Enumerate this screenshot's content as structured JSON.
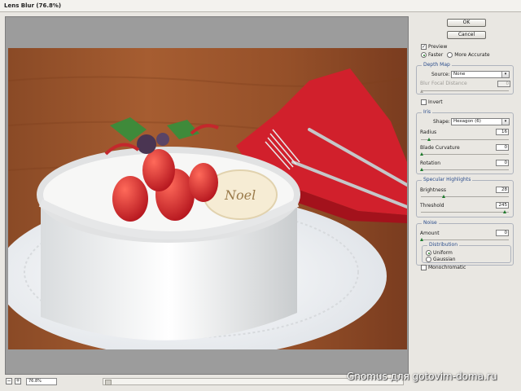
{
  "window": {
    "title": "Lens Blur (76.8%)"
  },
  "buttons": {
    "ok": "OK",
    "cancel": "Cancel"
  },
  "preview": {
    "label": "Preview",
    "checked": true,
    "faster": "Faster",
    "more_accurate": "More Accurate",
    "selected": "Faster"
  },
  "depth_map": {
    "legend": "Depth Map",
    "source_label": "Source:",
    "source_value": "None",
    "blur_focal_label": "Blur Focal Distance",
    "blur_focal_value": "0",
    "invert_label": "Invert"
  },
  "iris": {
    "legend": "Iris",
    "shape_label": "Shape:",
    "shape_value": "Hexagon (6)",
    "radius_label": "Radius",
    "radius_value": "16",
    "blade_curvature_label": "Blade Curvature",
    "blade_curvature_value": "0",
    "rotation_label": "Rotation",
    "rotation_value": "0"
  },
  "specular": {
    "legend": "Specular Highlights",
    "brightness_label": "Brightness",
    "brightness_value": "28",
    "threshold_label": "Threshold",
    "threshold_value": "245"
  },
  "noise": {
    "legend": "Noise",
    "amount_label": "Amount",
    "amount_value": "0",
    "distribution_legend": "Distribution",
    "uniform": "Uniform",
    "gaussian": "Gaussian",
    "selected": "Uniform",
    "monochromatic": "Monochromatic"
  },
  "statusbar": {
    "zoom_out": "−",
    "zoom_in": "+",
    "zoom_value": "76.8%"
  },
  "watermark": "Gnomus для gotovim-doma.ru",
  "icons": {
    "dropdown": "chevron-down-icon",
    "checkmark": "check-icon"
  },
  "colors": {
    "accent_green": "#1d7a2c",
    "legend_blue": "#2b4d8c"
  }
}
